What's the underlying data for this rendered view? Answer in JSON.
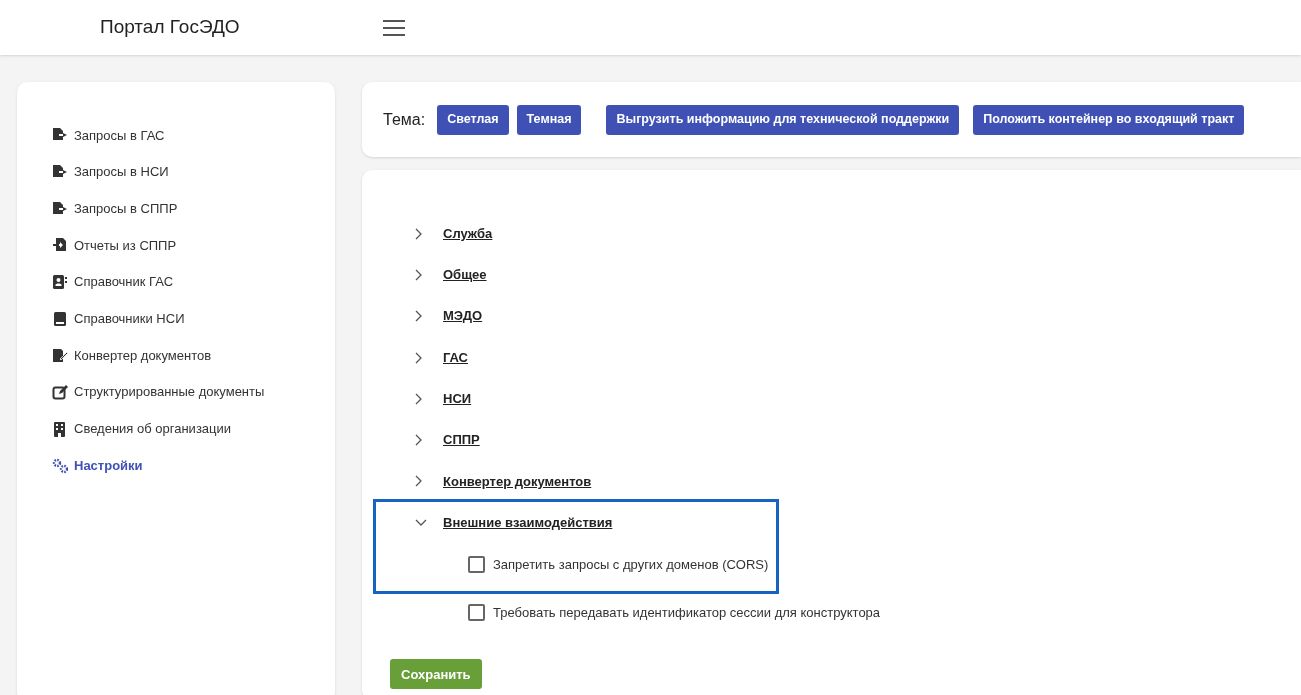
{
  "header": {
    "title": "Портал ГосЭДО"
  },
  "sidebar": {
    "items": [
      {
        "label": "Запросы в ГАС",
        "kind": "export",
        "selected": false
      },
      {
        "label": "Запросы в НСИ",
        "kind": "export",
        "selected": false
      },
      {
        "label": "Запросы в СППР",
        "kind": "export",
        "selected": false
      },
      {
        "label": "Отчеты из СППР",
        "kind": "import",
        "selected": false
      },
      {
        "label": "Справочник ГАС",
        "kind": "contacts",
        "selected": false
      },
      {
        "label": "Справочники НСИ",
        "kind": "book",
        "selected": false
      },
      {
        "label": "Конвертер документов",
        "kind": "signature",
        "selected": false
      },
      {
        "label": "Структурированные документы",
        "kind": "edit",
        "selected": false
      },
      {
        "label": "Сведения об организации",
        "kind": "building",
        "selected": false
      },
      {
        "label": "Настройки",
        "kind": "gears",
        "selected": true
      }
    ]
  },
  "toolbar": {
    "theme_label": "Тема:",
    "theme_buttons": [
      "Светлая",
      "Темная"
    ],
    "actions": [
      "Выгрузить информацию для технической поддержки",
      "Положить контейнер во входящий тракт"
    ]
  },
  "sections": [
    {
      "title": "Служба",
      "expanded": false,
      "highlighted": false
    },
    {
      "title": "Общее",
      "expanded": false,
      "highlighted": false
    },
    {
      "title": "МЭДО",
      "expanded": false,
      "highlighted": false
    },
    {
      "title": "ГАС",
      "expanded": false,
      "highlighted": false
    },
    {
      "title": "НСИ",
      "expanded": false,
      "highlighted": false
    },
    {
      "title": "СППР",
      "expanded": false,
      "highlighted": false
    },
    {
      "title": "Конвертер документов",
      "expanded": false,
      "highlighted": false
    },
    {
      "title": "Внешние взаимодействия",
      "expanded": true,
      "highlighted": true,
      "options": [
        {
          "label": "Запретить запросы с других доменов (CORS)",
          "checked": false,
          "highlighted": true
        },
        {
          "label": "Требовать передавать идентификатор сессии для конструктора",
          "checked": false,
          "highlighted": false
        }
      ]
    }
  ],
  "save_button": "Сохранить"
}
